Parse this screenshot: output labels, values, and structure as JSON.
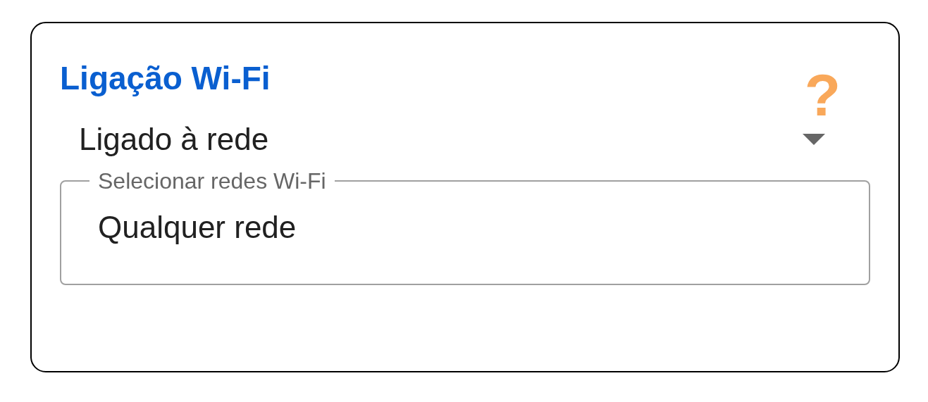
{
  "card": {
    "title": "Ligação Wi-Fi",
    "help": "?",
    "dropdown": {
      "value": "Ligado à rede"
    },
    "network_field": {
      "label": "Selecionar redes Wi-Fi",
      "value": "Qualquer rede"
    }
  }
}
